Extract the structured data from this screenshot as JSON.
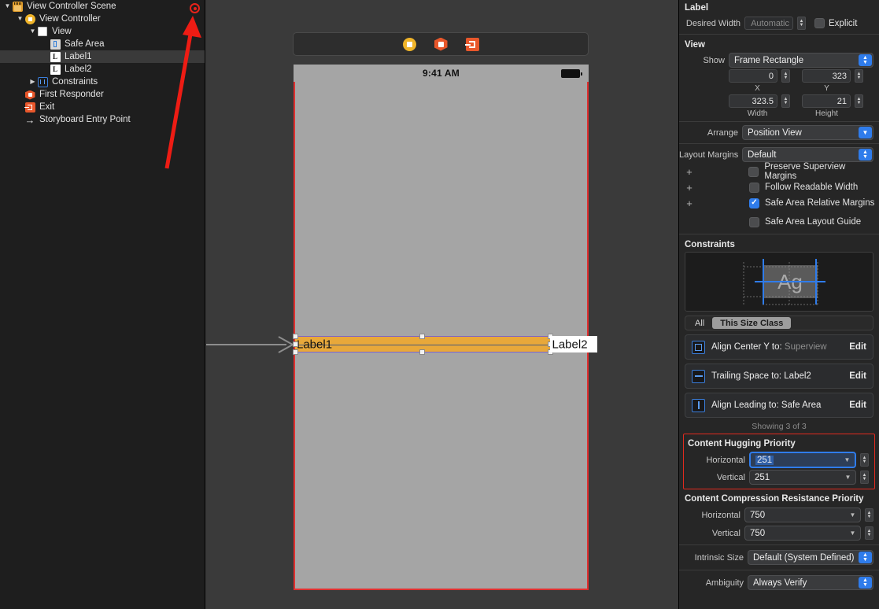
{
  "outline": {
    "error_badge": "error-badge",
    "rows": [
      {
        "label": "View Controller Scene",
        "indent": 0,
        "disclosure": "▼",
        "icon": "scene-icon",
        "selected": false
      },
      {
        "label": "View Controller",
        "indent": 1,
        "disclosure": "▼",
        "icon": "view-controller-icon",
        "selected": false
      },
      {
        "label": "View",
        "indent": 2,
        "disclosure": "▼",
        "icon": "view-icon",
        "selected": false
      },
      {
        "label": "Safe Area",
        "indent": 3,
        "disclosure": "",
        "icon": "safe-area-icon",
        "selected": false
      },
      {
        "label": "Label1",
        "indent": 3,
        "disclosure": "",
        "icon": "label-icon",
        "selected": true
      },
      {
        "label": "Label2",
        "indent": 3,
        "disclosure": "",
        "icon": "label-icon",
        "selected": false
      },
      {
        "label": "Constraints",
        "indent": 2,
        "disclosure": "▶",
        "icon": "constraints-icon",
        "selected": false
      },
      {
        "label": "First Responder",
        "indent": 1,
        "disclosure": "",
        "icon": "first-responder-icon",
        "selected": false
      },
      {
        "label": "Exit",
        "indent": 1,
        "disclosure": "",
        "icon": "exit-icon",
        "selected": false
      },
      {
        "label": "Storyboard Entry Point",
        "indent": 1,
        "disclosure": "",
        "icon": "entry-point-arrow-icon",
        "selected": false
      }
    ]
  },
  "canvas": {
    "toolbar_icons": [
      "view-controller-icon",
      "first-responder-icon",
      "exit-icon"
    ],
    "status_time": "9:41 AM",
    "label1": "Label1",
    "label2": "Label2"
  },
  "inspector": {
    "label_section": {
      "title": "Label",
      "desired_width_label": "Desired Width",
      "desired_width_value": "Automatic",
      "explicit_label": "Explicit",
      "explicit_checked": false
    },
    "view_section": {
      "title": "View",
      "show_label": "Show",
      "show_value": "Frame Rectangle",
      "x_value": "0",
      "x_label": "X",
      "y_value": "323",
      "y_label": "Y",
      "width_value": "323.5",
      "width_label": "Width",
      "height_value": "21",
      "height_label": "Height",
      "arrange_label": "Arrange",
      "arrange_value": "Position View",
      "layout_margins_label": "Layout Margins",
      "layout_margins_value": "Default",
      "checkboxes": [
        {
          "label": "Preserve Superview Margins",
          "checked": false,
          "plus": "+"
        },
        {
          "label": "Follow Readable Width",
          "checked": false,
          "plus": "+"
        },
        {
          "label": "Safe Area Relative Margins",
          "checked": true,
          "plus": "+"
        },
        {
          "label": "Safe Area Layout Guide",
          "checked": false,
          "plus": ""
        }
      ]
    },
    "constraints_section": {
      "title": "Constraints",
      "preview_glyph": "Ag",
      "segments": [
        {
          "label": "All",
          "selected": false
        },
        {
          "label": "This Size Class",
          "selected": true
        }
      ],
      "rows": [
        {
          "icon": "align-center-y-icon",
          "prefix": "Align Center Y to:",
          "target": "Superview",
          "target_dim": true,
          "edit": "Edit"
        },
        {
          "icon": "trailing-space-icon",
          "prefix": "Trailing Space to:",
          "target": "Label2",
          "target_dim": false,
          "edit": "Edit"
        },
        {
          "icon": "align-leading-icon",
          "prefix": "Align Leading to:",
          "target": "Safe Area",
          "target_dim": false,
          "edit": "Edit"
        }
      ],
      "showing": "Showing 3 of 3"
    },
    "hugging_section": {
      "title": "Content Hugging Priority",
      "horizontal_label": "Horizontal",
      "horizontal_value": "251",
      "vertical_label": "Vertical",
      "vertical_value": "251",
      "highlight_color": "#e02a1e",
      "focus_color": "#2f7ceb"
    },
    "compression_section": {
      "title": "Content Compression Resistance Priority",
      "horizontal_label": "Horizontal",
      "horizontal_value": "750",
      "vertical_label": "Vertical",
      "vertical_value": "750"
    },
    "intrinsic_size_label": "Intrinsic Size",
    "intrinsic_size_value": "Default (System Defined)",
    "ambiguity_label": "Ambiguity",
    "ambiguity_value": "Always Verify"
  }
}
